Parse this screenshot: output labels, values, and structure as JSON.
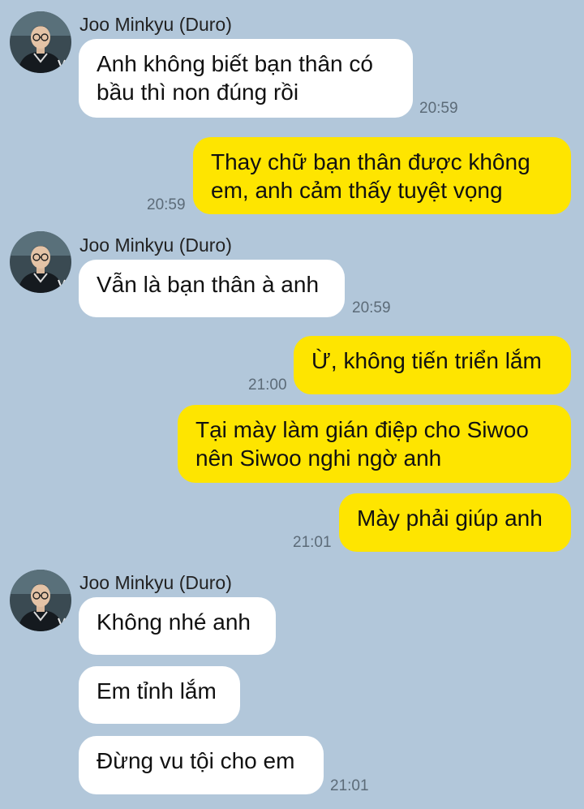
{
  "theme": {
    "background": "#b2c7da",
    "incoming_bubble": "#ffffff",
    "outgoing_bubble": "#fee500"
  },
  "avatar_icon": "profile-photo-icon",
  "sender_name": "Joo Minkyu (Duro)",
  "messages": [
    {
      "direction": "incoming",
      "lines": [
        "Anh không biết bạn thân có",
        "bầu thì non đúng rồi"
      ],
      "time": "20:59"
    },
    {
      "direction": "outgoing",
      "lines": [
        "Thay chữ bạn thân được không",
        "em, anh cảm thấy tuyệt vọng"
      ],
      "time": "20:59"
    },
    {
      "direction": "incoming",
      "lines": [
        "Vẫn là bạn thân à anh"
      ],
      "time": "20:59"
    },
    {
      "direction": "outgoing",
      "lines": [
        "Ừ, không tiến triển lắm"
      ],
      "time": "21:00"
    },
    {
      "direction": "outgoing",
      "lines": [
        "Tại mày làm gián điệp cho Siwoo",
        "nên Siwoo nghi ngờ anh"
      ],
      "time": ""
    },
    {
      "direction": "outgoing",
      "lines": [
        "Mày phải giúp anh"
      ],
      "time": "21:01"
    },
    {
      "direction": "incoming",
      "lines": [
        "Không nhé anh"
      ],
      "time": ""
    },
    {
      "direction": "incoming",
      "lines": [
        "Em tỉnh lắm"
      ],
      "time": ""
    },
    {
      "direction": "incoming",
      "lines": [
        "Đừng vu tội cho em"
      ],
      "time": "21:01"
    }
  ]
}
